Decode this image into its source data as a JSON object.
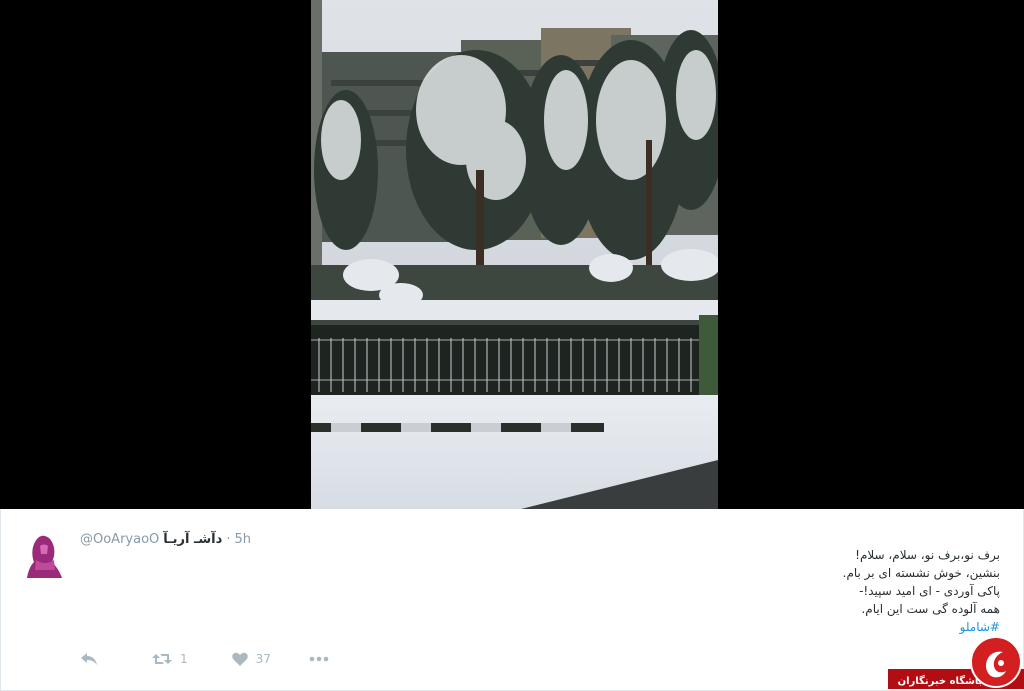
{
  "tweet": {
    "handle": "@OoAryaoO",
    "display_name": "دآشـ آریـآ",
    "separator": "·",
    "time": "5h",
    "text_lines": [
      "برف نو،برف نو، سلام، سلام!",
      "بنشین، خوش نشسته ای بر بام.",
      "پاکی آوردی - ای امید سپید!-",
      "همه آلوده گی ست این ایام."
    ],
    "hashtag": "#شاملو"
  },
  "actions": {
    "reply_icon": "reply-icon",
    "retweet_icon": "retweet-icon",
    "retweet_count": "1",
    "like_icon": "heart-icon",
    "like_count": "37",
    "more_icon": "more-dots-icon"
  },
  "watermark": {
    "text": "باشگاه خبرنگاران"
  },
  "colors": {
    "text": "#292f33",
    "muted": "#8899a6",
    "link": "#1b95e0",
    "icon": "#aab8c2",
    "brand_red": "#c0141b"
  }
}
